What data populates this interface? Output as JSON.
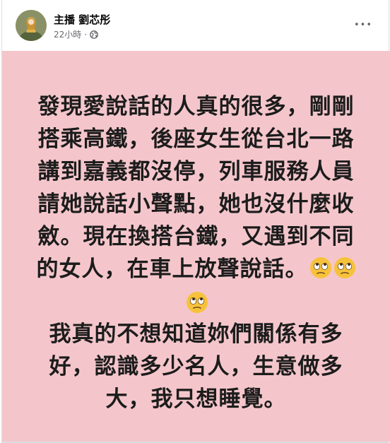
{
  "post": {
    "author": "主播 劉芯彤",
    "timestamp": "22小時",
    "meta_separator": "·",
    "privacy_icon": "globe-icon",
    "more_label": "•••",
    "body_lines": [
      "發現愛說話的人真的很多，剛剛",
      "搭乘高鐵，後座女生從台北一路",
      "講到嘉義都沒停，列車服務人員",
      "請她說話小聲點，她也沒什麼收",
      "斂。現在換搭台鐵，又遇到不同",
      "的女人，在車上放聲說話。"
    ],
    "body_lines_2": [
      "我真的不想知道妳們關係有多",
      "好，認識多少名人，生意做多",
      "大，我只想睡覺。"
    ],
    "emoji_name": "face-with-rolling-eyes",
    "background_color": "#f4c6cb",
    "text_color": "#1c1c1c"
  }
}
